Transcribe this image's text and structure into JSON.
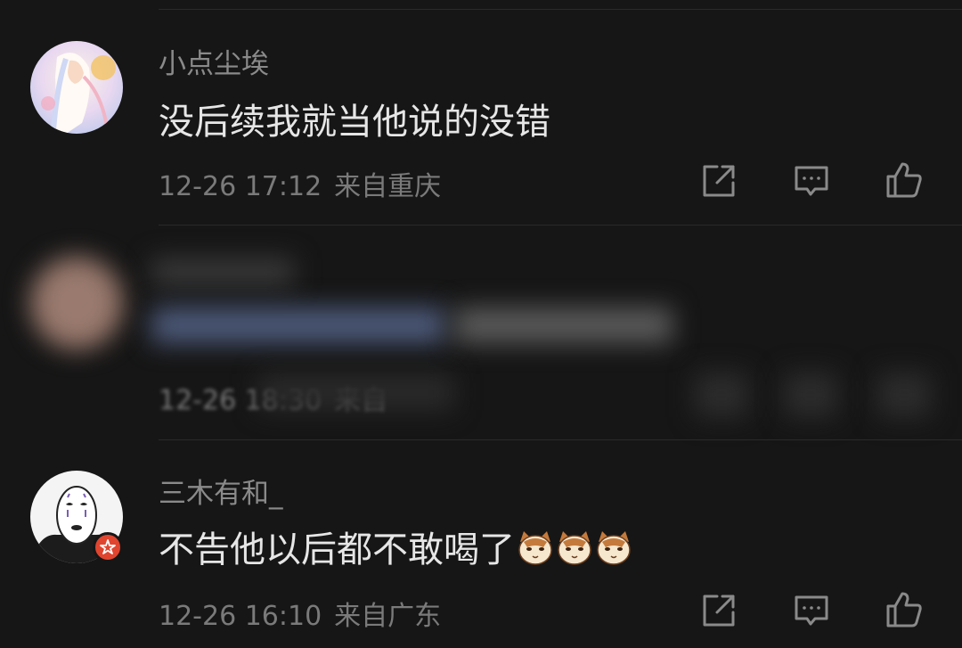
{
  "comments": [
    {
      "username": "小点尘埃",
      "text": "没后续我就当他说的没错",
      "date": "12-26 17:12",
      "location": "来自重庆",
      "avatar": "anime-illustration-avatar"
    },
    {
      "username": "",
      "text": "",
      "date": "12-26 18:30",
      "location": "来自",
      "blurred": true,
      "avatar": "blurred-avatar"
    },
    {
      "username": "三木有和_",
      "text": "不告他以后都不敢喝了",
      "emoji": [
        "cat-emoji",
        "cat-emoji",
        "cat-emoji"
      ],
      "date": "12-26 16:10",
      "location": "来自广东",
      "avatar": "no-face-mask-avatar",
      "badge": "red-star-badge"
    }
  ],
  "icons": {
    "share": "share-icon",
    "reply": "comment-icon",
    "like": "thumbs-up-icon"
  },
  "colors": {
    "background": "#161616",
    "username": "#8a8a8a",
    "text": "#e6e6e6",
    "meta": "#7a7a7a",
    "badge": "#e0452f"
  }
}
